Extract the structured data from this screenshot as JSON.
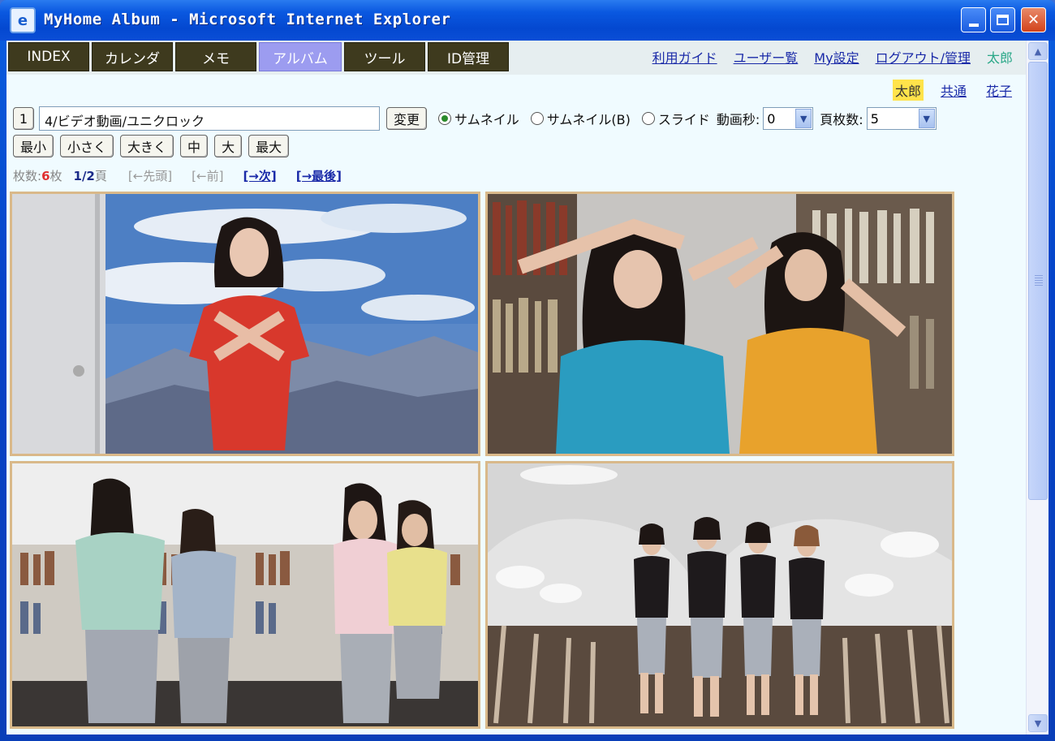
{
  "window": {
    "title": "MyHome Album - Microsoft Internet Explorer",
    "icon": "ie-icon"
  },
  "nav": {
    "tabs": [
      {
        "label": "INDEX",
        "active": false
      },
      {
        "label": "カレンダ",
        "active": false
      },
      {
        "label": "メモ",
        "active": false
      },
      {
        "label": "アルバム",
        "active": true
      },
      {
        "label": "ツール",
        "active": false
      },
      {
        "label": "ID管理",
        "active": false
      }
    ],
    "links": [
      "利用ガイド",
      "ユーザー覧",
      "My設定",
      "ログアウト/管理"
    ],
    "current_user": "太郎"
  },
  "users": [
    {
      "name": "太郎",
      "selected": true
    },
    {
      "name": "共通",
      "selected": false
    },
    {
      "name": "花子",
      "selected": false
    }
  ],
  "toolbar": {
    "num_label": "1",
    "path_value": "4/ビデオ動画/ユニクロック",
    "change_label": "変更",
    "view_modes": [
      {
        "label": "サムネイル",
        "checked": true
      },
      {
        "label": "サムネイル(B)",
        "checked": false
      },
      {
        "label": "スライド",
        "checked": false
      }
    ],
    "seconds_label": "動画秒:",
    "seconds_value": "0",
    "per_page_label": "頁枚数:",
    "per_page_value": "5"
  },
  "sizes": [
    "最小",
    "小さく",
    "大きく",
    "中",
    "大",
    "最大"
  ],
  "paging": {
    "count_label": "枚数:",
    "count_value": "6",
    "count_unit": "枚",
    "page_current": "1/2",
    "page_unit": "頁",
    "first_label": "[←先頭]",
    "prev_label": "[←前]",
    "next_label": "[→次]",
    "last_label": "[→最後]"
  },
  "photos": [
    {
      "name": "photo-woman-red-shirt"
    },
    {
      "name": "photo-two-women-frame-hands"
    },
    {
      "name": "photo-women-library"
    },
    {
      "name": "photo-four-women-hall"
    }
  ],
  "colors": {
    "tab_bg": "#3e3a1e",
    "tab_active": "#9c9cf0",
    "link": "#1a2aa8",
    "selected_user_bg": "#ffe34a",
    "photo_border": "#d9b98a"
  }
}
